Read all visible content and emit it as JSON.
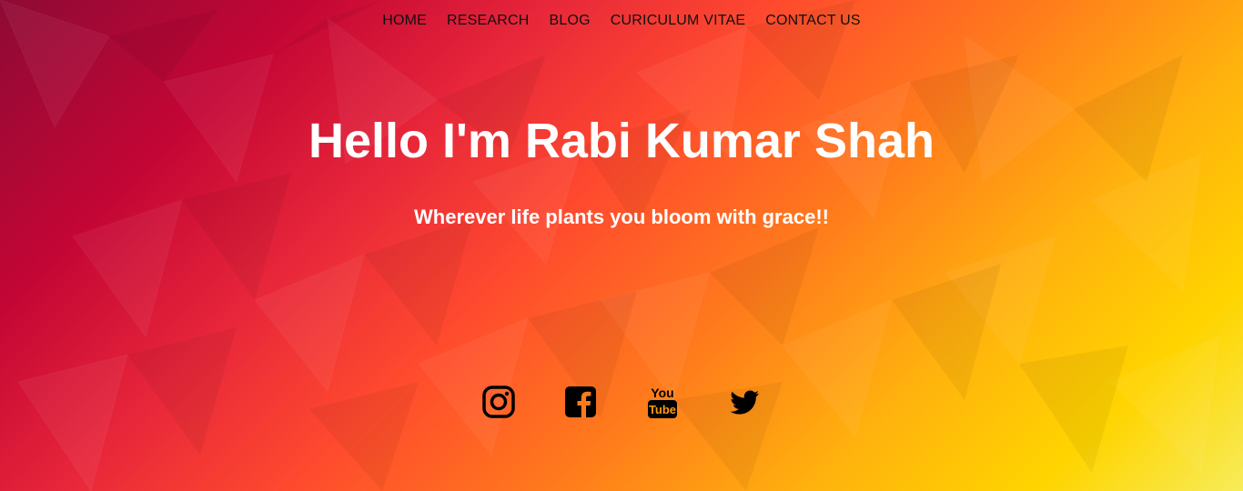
{
  "nav": {
    "items": [
      {
        "label": "HOME"
      },
      {
        "label": "RESEARCH"
      },
      {
        "label": "BLOG"
      },
      {
        "label": "CURICULUM VITAE"
      },
      {
        "label": "CONTACT US"
      }
    ]
  },
  "hero": {
    "title": "Hello I'm Rabi Kumar Shah",
    "tagline": "Wherever life plants you bloom with grace!!"
  },
  "social": {
    "icons": [
      {
        "name": "instagram-icon"
      },
      {
        "name": "facebook-icon"
      },
      {
        "name": "youtube-icon",
        "text_top": "You",
        "text_bottom": "Tube"
      },
      {
        "name": "twitter-icon"
      }
    ]
  },
  "colors": {
    "nav_text": "#111111",
    "heading_text": "#ffffff",
    "icon": "#000000",
    "gradient_start": "#8e0a35",
    "gradient_mid": "#ff4a2e",
    "gradient_end": "#f7ec5a"
  }
}
